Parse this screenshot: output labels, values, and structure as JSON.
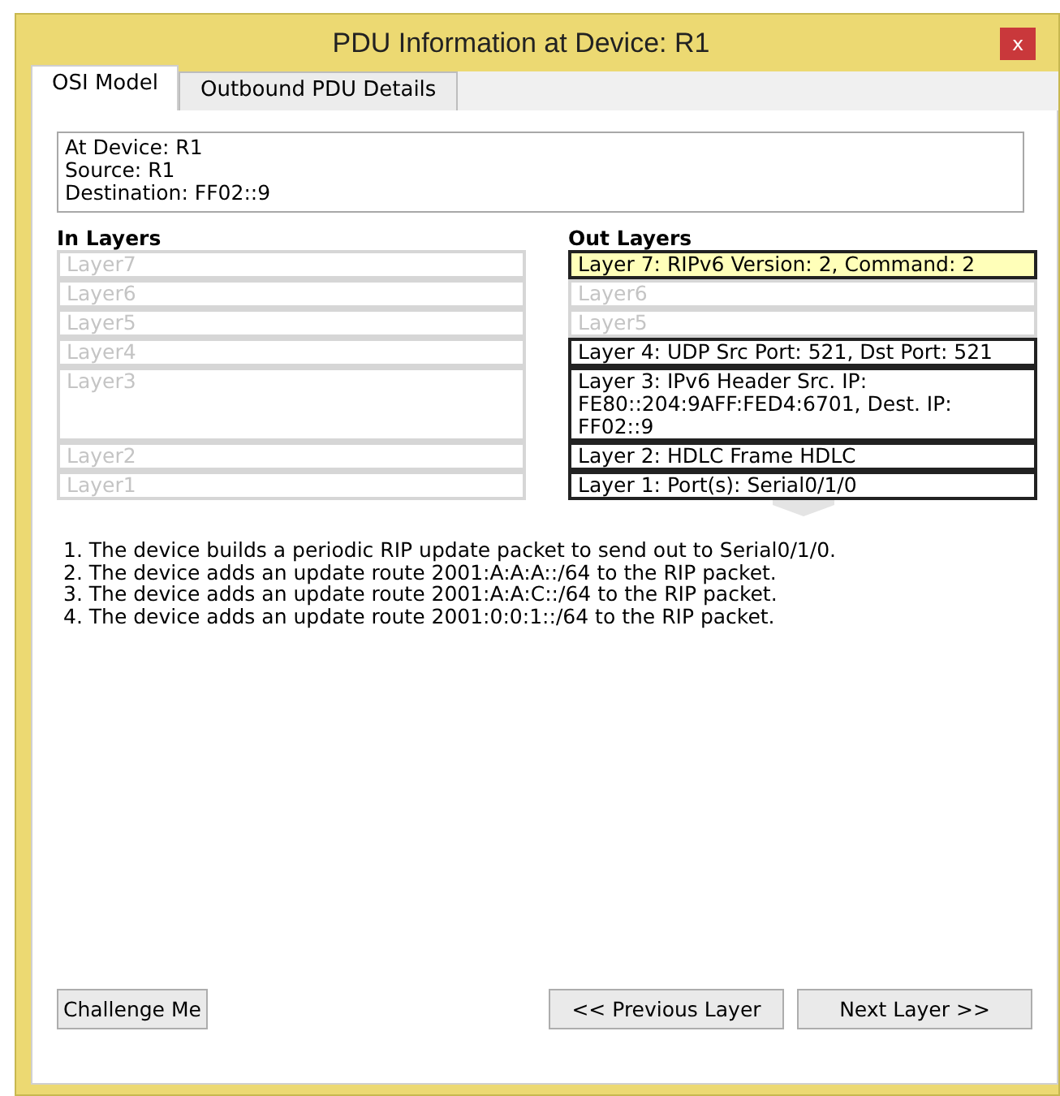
{
  "window": {
    "title": "PDU Information at Device: R1",
    "close": "x"
  },
  "tabs": [
    {
      "label": "OSI Model",
      "selected": true
    },
    {
      "label": "Outbound PDU Details",
      "selected": false
    }
  ],
  "device_info": [
    "At Device: R1",
    "Source: R1",
    "Destination: FF02::9"
  ],
  "in_layers": {
    "heading": "In Layers",
    "layers": [
      {
        "text": "Layer7",
        "active": false,
        "selected": false
      },
      {
        "text": "Layer6",
        "active": false,
        "selected": false
      },
      {
        "text": "Layer5",
        "active": false,
        "selected": false
      },
      {
        "text": "Layer4",
        "active": false,
        "selected": false
      },
      {
        "text": "Layer3",
        "active": false,
        "selected": false
      },
      {
        "text": "Layer2",
        "active": false,
        "selected": false
      },
      {
        "text": "Layer1",
        "active": false,
        "selected": false
      }
    ]
  },
  "out_layers": {
    "heading": "Out Layers",
    "layers": [
      {
        "text": "Layer 7: RIPv6 Version: 2, Command: 2",
        "active": true,
        "selected": true
      },
      {
        "text": "Layer6",
        "active": false,
        "selected": false
      },
      {
        "text": "Layer5",
        "active": false,
        "selected": false
      },
      {
        "text": "Layer 4: UDP Src Port: 521, Dst Port: 521",
        "active": true,
        "selected": false
      },
      {
        "text": "Layer 3: IPv6 Header Src. IP: FE80::204:9AFF:FED4:6701, Dest. IP: FF02::9",
        "active": true,
        "selected": false
      },
      {
        "text": "Layer 2: HDLC Frame HDLC",
        "active": true,
        "selected": false
      },
      {
        "text": "Layer 1: Port(s): Serial0/1/0",
        "active": true,
        "selected": false
      }
    ]
  },
  "description": [
    "1. The device builds a periodic RIP update packet to send out to Serial0/1/0.",
    "2. The device adds an update route 2001:A:A:A::/64 to the RIP packet.",
    "3. The device adds an update route 2001:A:A:C::/64 to the RIP packet.",
    "4. The device adds an update route 2001:0:0:1::/64 to the RIP packet."
  ],
  "buttons": {
    "left": [
      "Challenge Me"
    ],
    "right": [
      "<< Previous Layer",
      "Next Layer >>"
    ]
  }
}
